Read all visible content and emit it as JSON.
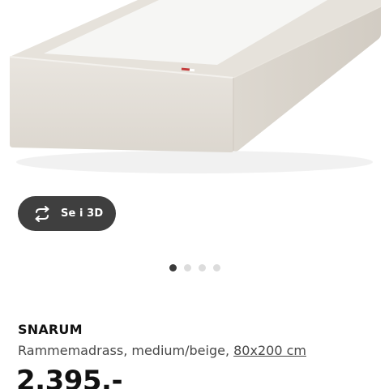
{
  "view_3d": {
    "label": "Se i 3D",
    "icon": "rotate-3d-icon"
  },
  "carousel": {
    "total": 4,
    "active_index": 1
  },
  "product": {
    "name": "SNARUM",
    "description": "Rammemadrass, medium/beige, ",
    "size_link": "80x200 cm",
    "price": "2.395,-"
  },
  "colors": {
    "button_bg": "#3f3f3f",
    "mattress_beige": "#e2ddd6",
    "mattress_top": "#f4f3f0",
    "active_dot": "#3a3a3a",
    "inactive_dot": "#dcdcdc"
  }
}
